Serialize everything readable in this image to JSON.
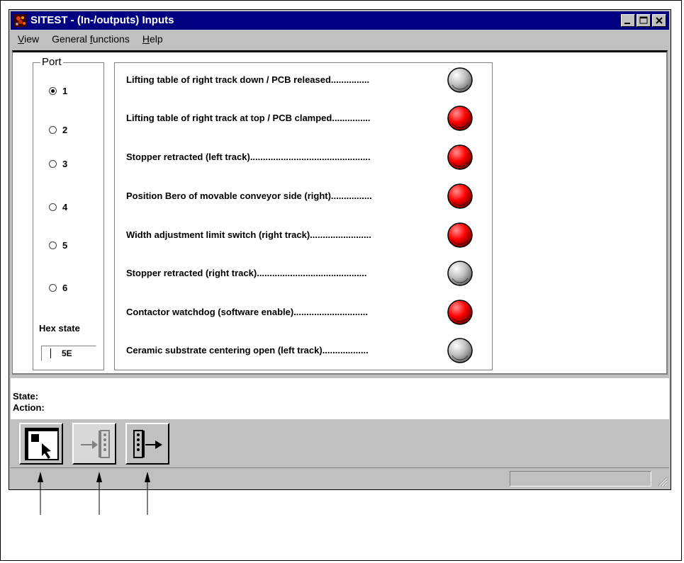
{
  "window": {
    "title": "SITEST - (In-/outputs) Inputs"
  },
  "menu": [
    {
      "pre": "",
      "ul": "V",
      "post": "iew"
    },
    {
      "pre": "General ",
      "ul": "f",
      "post": "unctions"
    },
    {
      "pre": "",
      "ul": "H",
      "post": "elp"
    }
  ],
  "port": {
    "legend": "Port",
    "options": [
      "1",
      "2",
      "3",
      "4",
      "5",
      "6"
    ],
    "selected_index": 0,
    "hex_label": "Hex state",
    "hex_value": "5E"
  },
  "inputs": [
    {
      "label": "Lifting table of right track down / PCB released...............",
      "active": false
    },
    {
      "label": "Lifting table of right track at top / PCB clamped...............",
      "active": true
    },
    {
      "label": "Stopper retracted (left track)...............................................",
      "active": true
    },
    {
      "label": "Position Bero of movable conveyor side (right)................",
      "active": true
    },
    {
      "label": "Width adjustment limit switch (right track)........................",
      "active": true
    },
    {
      "label": "Stopper retracted (right track)...........................................",
      "active": false
    },
    {
      "label": "Contactor watchdog (software enable).............................",
      "active": true
    },
    {
      "label": "Ceramic substrate centering open (left track)..................",
      "active": false
    }
  ],
  "status": {
    "state_label": "State:",
    "action_label": "Action:"
  },
  "toolbar": [
    {
      "icon": "select-pointer-icon",
      "enabled": true
    },
    {
      "icon": "inputs-icon",
      "enabled": false
    },
    {
      "icon": "outputs-icon",
      "enabled": true
    }
  ],
  "colors": {
    "lamp_on": "#ff0000",
    "lamp_off": "#c0c0c0",
    "titlebar": "#000080"
  }
}
